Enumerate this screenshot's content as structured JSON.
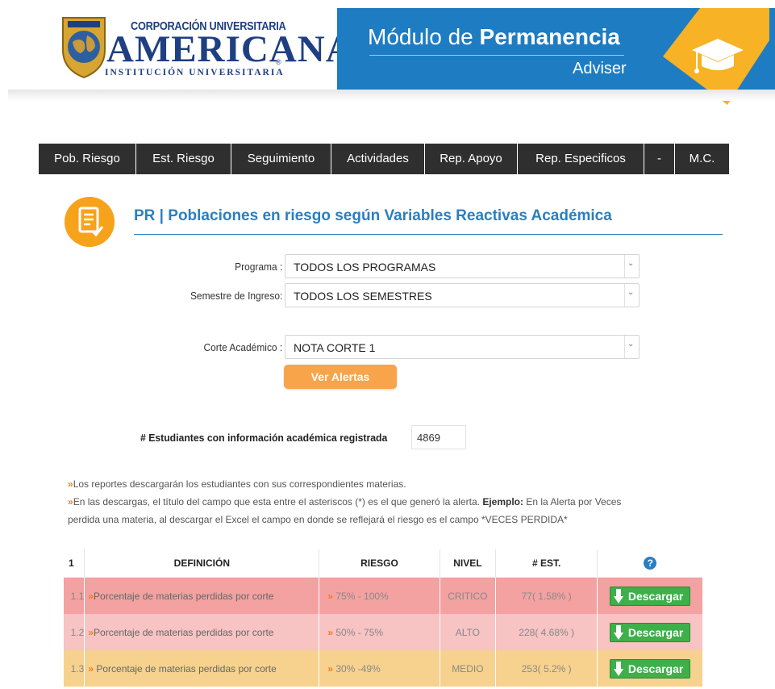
{
  "header": {
    "logo_line1": "CORPORACIÓN UNIVERSITARIA",
    "logo_line2": "AMERICANA",
    "logo_line3": "INSTITUCIÓN UNIVERSITARIA",
    "logo_reg": "®",
    "module_title_prefix": "Módulo de",
    "module_title_bold": "Permanencia",
    "module_subtitle": "Adviser"
  },
  "nav": {
    "items": [
      "Pob. Riesgo",
      "Est. Riesgo",
      "Seguimiento",
      "Actividades",
      "Rep. Apoyo",
      "Rep. Especificos",
      "-",
      "M.C."
    ]
  },
  "page": {
    "title": "PR | Poblaciones en riesgo según Variables Reactivas Académica"
  },
  "form": {
    "programa_label": "Programa :",
    "programa_value": "TODOS LOS PROGRAMAS",
    "semestre_label": "Semestre de Ingreso:",
    "semestre_value": "TODOS LOS SEMESTRES",
    "corte_label": "Corte Académico :",
    "corte_value": "NOTA CORTE 1",
    "submit_label": "Ver Alertas"
  },
  "students": {
    "label": "# Estudiantes con información académica registrada",
    "value": "4869"
  },
  "notes": {
    "marker": "»",
    "note1": "Los reportes descargarán los estudiantes con sus correspondientes materias.",
    "note2_a": "En las descargas, el título del campo que esta entre el asteriscos (*) es el que generó la alerta.",
    "note2_bold": "Ejemplo:",
    "note2_b": "En la Alerta por Veces",
    "note2_c": "perdida una materia, al descargar el Excel el campo en donde se reflejará el riesgo es el campo *VECES PERDIDA*"
  },
  "table": {
    "headers": {
      "num": "1",
      "definicion": "DEFINICIÓN",
      "riesgo": "RIESGO",
      "nivel": "NIVEL",
      "est": "# EST.",
      "help": "?"
    },
    "rows": [
      {
        "num": "1.1",
        "definicion": "Porcentaje de materias perdidas por corte",
        "riesgo": "75% - 100%",
        "nivel": "CRITICO",
        "est": "77( 1.58% )",
        "button": "Descargar"
      },
      {
        "num": "1.2",
        "definicion": "Porcentaje de materias perdidas por corte",
        "riesgo": "50% - 75%",
        "nivel": "ALTO",
        "est": "228( 4.68% )",
        "button": "Descargar"
      },
      {
        "num": "1.3",
        "definicion": " Porcentaje de materias perdidas por corte",
        "riesgo": "30% -49%",
        "nivel": "MEDIO",
        "est": "253( 5.2% )",
        "button": "Descargar"
      }
    ]
  },
  "colors": {
    "header_blue": "#1e7cc3",
    "title_blue": "#2a7fc1",
    "accent_orange": "#f7a44a",
    "nav_dark": "#2f2f2f",
    "critical_red": "#f4a1a1",
    "high_pink": "#f7c3c3",
    "medium_yellow": "#f7d28e",
    "download_green": "#3db04a"
  },
  "icons": {
    "logo": "globe-shield-logo",
    "badge": "graduation-cap-icon",
    "title": "document-check-icon",
    "select_arrow": "chevron-down-icon",
    "download": "arrow-down-icon",
    "help": "help-icon"
  }
}
